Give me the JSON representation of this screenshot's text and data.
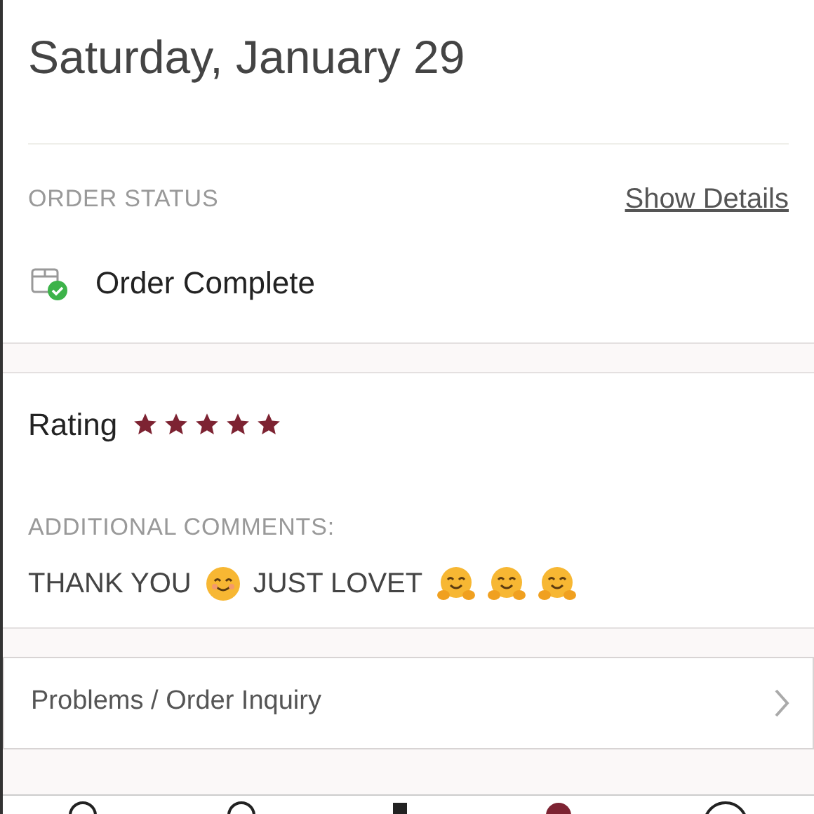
{
  "date": "Saturday, January 29",
  "order_status": {
    "label": "ORDER STATUS",
    "link": "Show Details",
    "status": "Order Complete"
  },
  "rating": {
    "label": "Rating",
    "stars": 5
  },
  "comments": {
    "label": "ADDITIONAL COMMENTS:",
    "parts": [
      {
        "kind": "text",
        "text": "THANK YOU"
      },
      {
        "kind": "smile"
      },
      {
        "kind": "text",
        "text": "JUST LOVET"
      },
      {
        "kind": "hug"
      },
      {
        "kind": "hug"
      },
      {
        "kind": "hug"
      }
    ]
  },
  "inquiry": {
    "label": "Problems / Order Inquiry"
  }
}
